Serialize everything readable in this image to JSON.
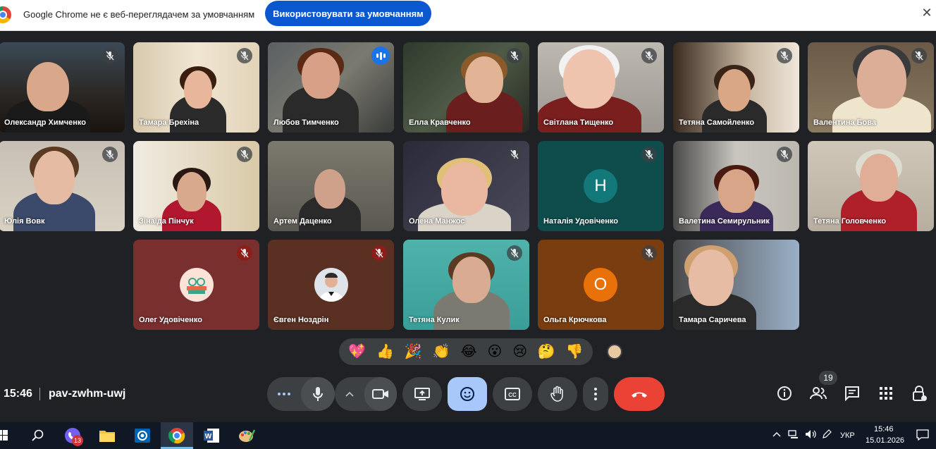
{
  "infobar": {
    "message": "Google Chrome не є веб-переглядачем за умовчанням",
    "button_label": "Використовувати за умовчанням",
    "close_glyph": "✕"
  },
  "participants": [
    {
      "name": "Олександр Химченко",
      "mic": "muted"
    },
    {
      "name": "Тамара Брехіна",
      "mic": "muted"
    },
    {
      "name": "Любов Тимченко",
      "mic": "speaking"
    },
    {
      "name": "Елла Кравченко",
      "mic": "muted"
    },
    {
      "name": "Світлана Тищенко",
      "mic": "muted"
    },
    {
      "name": "Тетяна Самойленко",
      "mic": "muted"
    },
    {
      "name": "Валентина Бова",
      "mic": "muted"
    },
    {
      "name": "Юлія Вовк",
      "mic": "muted"
    },
    {
      "name": "Зінаїда Пінчук",
      "mic": "muted"
    },
    {
      "name": "Артем Даценко",
      "mic": "on"
    },
    {
      "name": "Олена Манжос",
      "mic": "muted"
    },
    {
      "name": "Наталія Удовіченко",
      "mic": "muted",
      "avatar_letter": "Н"
    },
    {
      "name": "Валетина Семирульник",
      "mic": "muted"
    },
    {
      "name": "Тетяна Головченко",
      "mic": "on"
    },
    {
      "name": "Олег Удовіченко",
      "mic": "muted"
    },
    {
      "name": "Євген Ноздрін",
      "mic": "muted"
    },
    {
      "name": "Тетяна Кулик",
      "mic": "muted"
    },
    {
      "name": "Ольга Крючкова",
      "mic": "muted",
      "avatar_letter": "О"
    },
    {
      "name": "Тамара Саричева",
      "mic": "on"
    }
  ],
  "reactions": [
    "💖",
    "👍",
    "🎉",
    "👏",
    "😂",
    "😮",
    "😢",
    "🤔",
    "👎"
  ],
  "meeting": {
    "time": "15:46",
    "code": "pav-zwhm-uwj",
    "participant_count": "19"
  },
  "colors": {
    "background": "#202124",
    "control": "#3c4043",
    "reactions_active": "#a8c7fa",
    "leave_call": "#ea4335",
    "infobar_button": "#0b57d0"
  },
  "taskbar": {
    "messenger_badge": "13",
    "language": "УКР",
    "time": "15:46",
    "date": "15.01.2026"
  }
}
